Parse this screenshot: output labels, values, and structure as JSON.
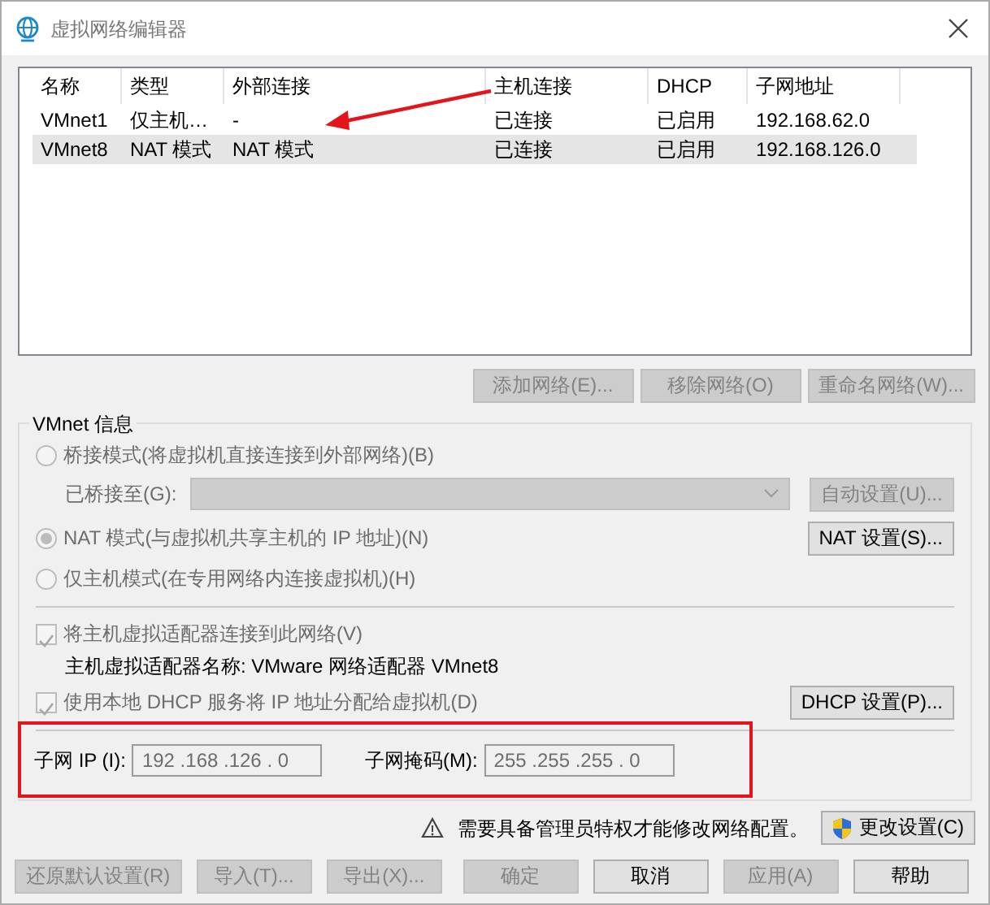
{
  "window": {
    "title": "虚拟网络编辑器"
  },
  "network_table": {
    "columns": [
      "名称",
      "类型",
      "外部连接",
      "主机连接",
      "DHCP",
      "子网地址"
    ],
    "rows": [
      {
        "cells": [
          "VMnet1",
          "仅主机…",
          "-",
          "已连接",
          "已启用",
          "192.168.62.0"
        ],
        "selected": false
      },
      {
        "cells": [
          "VMnet8",
          "NAT 模式",
          "NAT 模式",
          "已连接",
          "已启用",
          "192.168.126.0"
        ],
        "selected": true
      }
    ]
  },
  "network_buttons": [
    {
      "label": "添加网络(E)...",
      "disabled": true
    },
    {
      "label": "移除网络(O)",
      "disabled": true
    },
    {
      "label": "重命名网络(W)...",
      "disabled": true
    }
  ],
  "vmnet_info": {
    "title": "VMnet 信息",
    "modes": [
      {
        "label": "桥接模式(将虚拟机直接连接到外部网络)(B)",
        "selected": false,
        "disabled": true
      },
      {
        "label": "NAT 模式(与虚拟机共享主机的 IP 地址)(N)",
        "selected": true,
        "disabled": true
      },
      {
        "label": "仅主机模式(在专用网络内连接虚拟机)(H)",
        "selected": false,
        "disabled": true
      }
    ],
    "bridged_to": {
      "label": "已桥接至(G):",
      "disabled": true
    },
    "auto_button": {
      "label": "自动设置(U)...",
      "disabled": true
    },
    "nat_button": {
      "label": "NAT 设置(S)...",
      "disabled": false
    },
    "connect_adapter": {
      "label": "将主机虚拟适配器连接到此网络(V)",
      "checked": true,
      "disabled": true
    },
    "adapter_name": "主机虚拟适配器名称: VMware 网络适配器 VMnet8",
    "use_dhcp": {
      "label": "使用本地 DHCP 服务将 IP 地址分配给虚拟机(D)",
      "checked": true,
      "disabled": true
    },
    "dhcp_button": {
      "label": "DHCP 设置(P)...",
      "disabled": false
    },
    "subnet_ip": {
      "label": "子网 IP (I):",
      "value": "192 .168 .126 . 0"
    },
    "subnet_mask": {
      "label": "子网掩码(M):",
      "value": "255 .255 .255 . 0"
    }
  },
  "notice": "需要具备管理员特权才能修改网络配置。",
  "change_button": {
    "label": "更改设置(C)",
    "disabled": false
  },
  "footer_buttons": [
    {
      "label": "还原默认设置(R)",
      "disabled": true
    },
    {
      "label": "导入(T)...",
      "disabled": true
    },
    {
      "label": "导出(X)...",
      "disabled": true
    },
    {
      "label": "确定",
      "disabled": true
    },
    {
      "label": "取消",
      "disabled": false
    },
    {
      "label": "应用(A)",
      "disabled": true
    },
    {
      "label": "帮助",
      "disabled": false
    }
  ]
}
